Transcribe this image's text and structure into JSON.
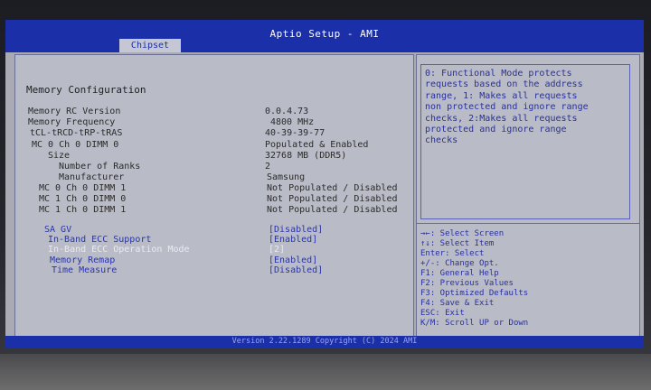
{
  "header": {
    "title": "Aptio Setup - AMI",
    "tab_label": "Chipset"
  },
  "main": {
    "section_title": "Memory Configuration",
    "info_rows": [
      {
        "label": "Memory RC Version",
        "value": "0.0.4.73"
      },
      {
        "label": "Memory Frequency",
        "value": "4800 MHz"
      },
      {
        "label": "tCL-tRCD-tRP-tRAS",
        "value": "40-39-39-77"
      },
      {
        "label": "MC 0 Ch 0 DIMM 0",
        "value": "Populated & Enabled"
      },
      {
        "label": "Size",
        "value": "32768 MB (DDR5)"
      },
      {
        "label": "Number of Ranks",
        "value": "2"
      },
      {
        "label": "Manufacturer",
        "value": "Samsung"
      },
      {
        "label": "MC 0 Ch 0 DIMM 1",
        "value": "Not Populated / Disabled"
      },
      {
        "label": "MC 1 Ch 0 DIMM 0",
        "value": "Not Populated / Disabled"
      },
      {
        "label": "MC 1 Ch 0 DIMM 1",
        "value": "Not Populated / Disabled"
      }
    ],
    "options": [
      {
        "label": "SA GV",
        "value": "[Disabled]"
      },
      {
        "label": "In-Band ECC Support",
        "value": "[Enabled]"
      },
      {
        "label": "In-Band ECC Operation Mode",
        "value": "[2]"
      },
      {
        "label": "Memory Remap",
        "value": "[Enabled]"
      },
      {
        "label": "Time Measure",
        "value": "[Disabled]"
      }
    ]
  },
  "help": {
    "description": "0: Functional Mode protects\nrequests based on the address\nrange, 1: Makes all requests\nnon protected and ignore range\nchecks, 2:Makes all requests\nprotected and ignore range\nchecks",
    "keys": [
      "→←: Select Screen",
      "↑↓: Select Item",
      "Enter: Select",
      "+/-: Change Opt.",
      "F1: General Help",
      "F2: Previous Values",
      "F3: Optimized Defaults",
      "F4: Save & Exit",
      "ESC: Exit",
      "K/M: Scroll UP or Down"
    ]
  },
  "footer": {
    "text": "Version 2.22.1289 Copyright (C) 2024 AMI"
  },
  "colors": {
    "bar_blue": "#1b2fa8",
    "panel_gray": "#b9bbc7",
    "option_blue": "#2a35a8"
  }
}
